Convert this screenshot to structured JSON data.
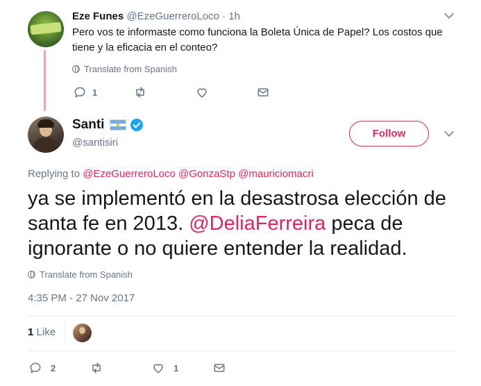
{
  "reply_tweet": {
    "name": "Eze Funes",
    "handle": "@EzeGuerreroLoco",
    "time": "· 1h",
    "text": "Pero vos te informaste como funciona la Boleta Única de Papel? Los costos que tiene y la eficacia en el conteo?",
    "translate_label": "Translate from Spanish",
    "actions": {
      "reply_count": "1"
    }
  },
  "main_tweet": {
    "name": "Santi",
    "handle": "@santisiri",
    "follow_label": "Follow",
    "replying_prefix": "Replying to",
    "replying_to": [
      "@EzeGuerreroLoco",
      "@GonzaStp",
      "@mauriciomacri"
    ],
    "text_before": "ya se implementó en la desastrosa elección de santa fe en 2013.",
    "text_mention": "@DeliaFerreira",
    "text_after": "peca de ignorante o no quiere entender la realidad.",
    "translate_label": "Translate from Spanish",
    "timestamp": "4:35 PM - 27 Nov 2017",
    "likes": {
      "count": "1",
      "label": "Like"
    },
    "actions": {
      "reply_count": "2",
      "like_count": "1"
    }
  },
  "colors": {
    "accent": "#e0245e",
    "muted": "#657786",
    "verified": "#1da1f2",
    "thread_line": "#f4a3b4"
  },
  "icons": [
    "reply-icon",
    "retweet-icon",
    "heart-icon",
    "dm-icon",
    "globe-icon",
    "verified-icon",
    "flag-argentina-icon",
    "chevron-down-icon"
  ]
}
